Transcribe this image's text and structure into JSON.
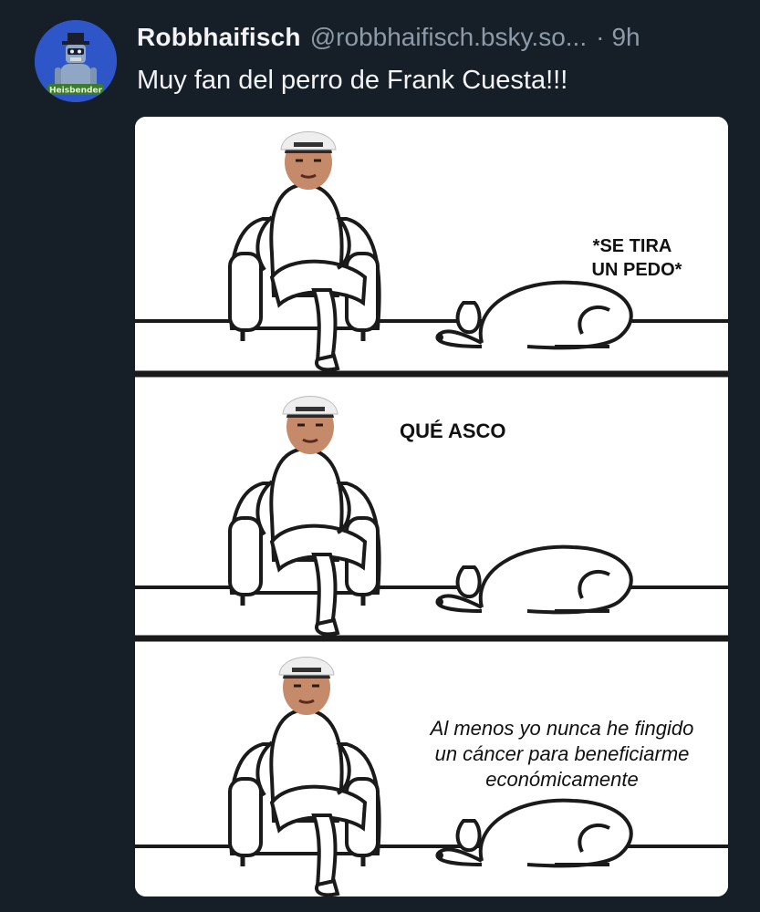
{
  "post": {
    "display_name": "Robbhaifisch",
    "handle": "@robbhaifisch.bsky.so...",
    "separator": "·",
    "time": "9h",
    "text": "Muy fan del perro de Frank Cuesta!!!",
    "avatar_label": "Heisbender"
  },
  "meme": {
    "panel1_caption_line1": "*SE TIRA",
    "panel1_caption_line2": "UN PEDO*",
    "panel2_caption": "QUÉ ASCO",
    "panel3_caption_line1": "Al menos yo nunca he fingido",
    "panel3_caption_line2": "un cáncer para beneficiarme",
    "panel3_caption_line3": "económicamente"
  },
  "colors": {
    "background": "#161e27",
    "text_primary": "#f1f3f5",
    "text_secondary": "#8d9aa8",
    "avatar_bg": "#2f56c9"
  }
}
